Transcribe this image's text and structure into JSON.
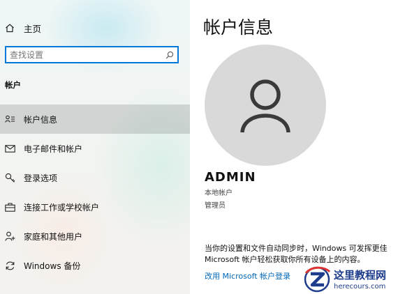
{
  "sidebar": {
    "home_label": "主页",
    "search_placeholder": "查找设置",
    "section_title": "帐户",
    "items": [
      {
        "label": "帐户信息",
        "icon": "account-info-icon",
        "selected": true
      },
      {
        "label": "电子邮件和帐户",
        "icon": "mail-icon"
      },
      {
        "label": "登录选项",
        "icon": "key-icon"
      },
      {
        "label": "连接工作或学校帐户",
        "icon": "briefcase-icon"
      },
      {
        "label": "家庭和其他用户",
        "icon": "person-add-icon"
      },
      {
        "label": "Windows 备份",
        "icon": "sync-icon"
      }
    ]
  },
  "main": {
    "title": "帐户信息",
    "user": {
      "name": "ADMIN",
      "account_type": "本地帐户",
      "role": "管理员"
    },
    "sync_text_line1": "当你的设置和文件自动同步时，Windows 可发挥更佳",
    "sync_text_line2": "Microsoft 帐户轻松获取你所有设备上的内容。",
    "link_label": "改用 Microsoft 帐户登录"
  },
  "watermark": {
    "text": "这里教程网",
    "url": "herecours.com"
  },
  "colors": {
    "accent": "#0078d7",
    "link": "#0067b8",
    "avatar_bg": "#d9d9d9",
    "selected_bg": "#dcdcdc"
  }
}
